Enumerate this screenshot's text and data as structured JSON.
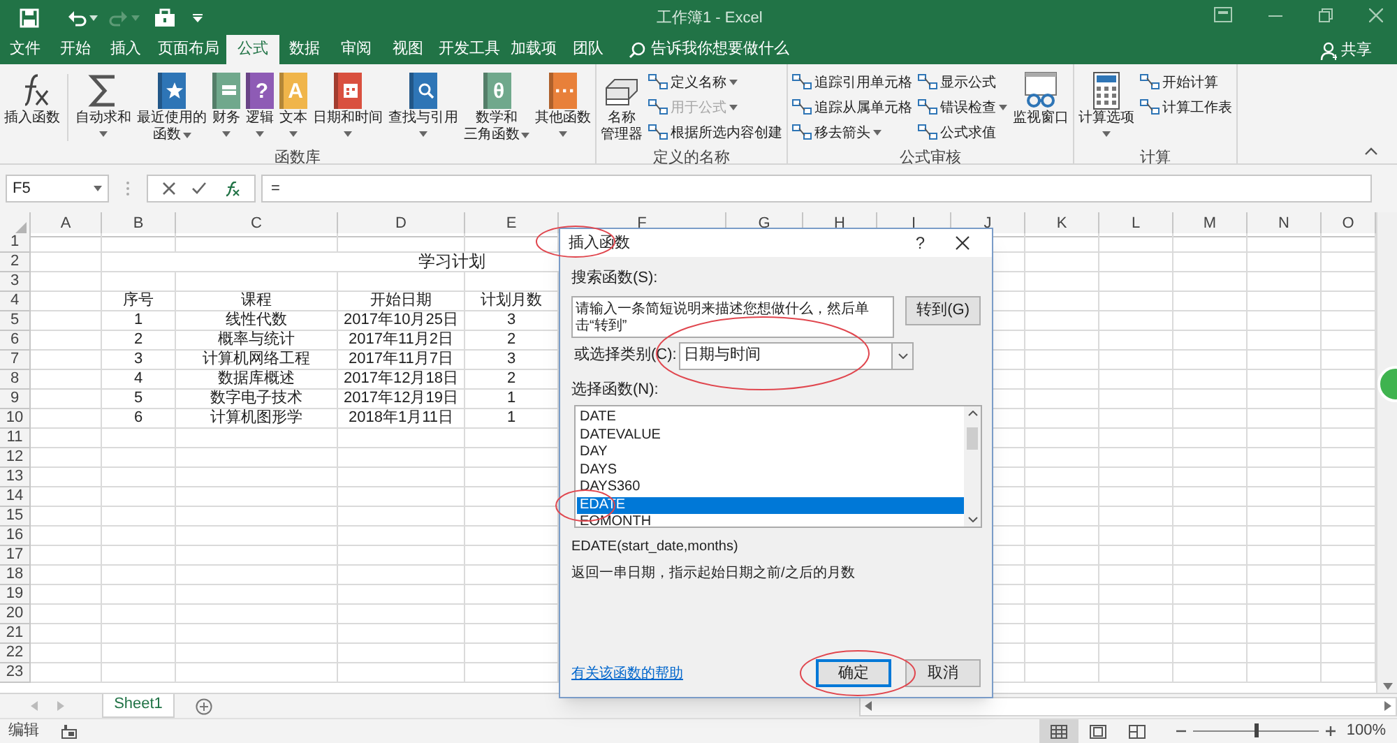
{
  "window": {
    "title": "工作簿1 - Excel"
  },
  "ribbon_tabs": [
    {
      "label": "文件",
      "selected": false
    },
    {
      "label": "开始",
      "selected": false
    },
    {
      "label": "插入",
      "selected": false
    },
    {
      "label": "页面布局",
      "selected": false
    },
    {
      "label": "公式",
      "selected": true
    },
    {
      "label": "数据",
      "selected": false
    },
    {
      "label": "审阅",
      "selected": false
    },
    {
      "label": "视图",
      "selected": false
    },
    {
      "label": "开发工具",
      "selected": false
    },
    {
      "label": "加载项",
      "selected": false
    },
    {
      "label": "团队",
      "selected": false
    }
  ],
  "tell_me": "告诉我你想要做什么",
  "share": "共享",
  "ribbon_groups": [
    {
      "label": "函数库",
      "buttons": [
        {
          "kind": "large",
          "lines": [
            "插入函数"
          ],
          "dropdown": false,
          "icon": {
            "kind": "fx"
          }
        },
        {
          "kind": "large",
          "lines": [
            "自动求和"
          ],
          "dropdown": true,
          "icon": {
            "kind": "sum"
          }
        },
        {
          "kind": "large",
          "lines": [
            "最近使用的",
            "函数"
          ],
          "dropdown": true,
          "icon": {
            "kind": "book_star",
            "color": "#2e75b6"
          }
        },
        {
          "kind": "large",
          "lines": [
            "财务"
          ],
          "dropdown": true,
          "icon": {
            "kind": "book_coins",
            "color": "#70a88c"
          }
        },
        {
          "kind": "large",
          "lines": [
            "逻辑"
          ],
          "dropdown": true,
          "icon": {
            "kind": "book",
            "color": "#8e5bb5",
            "glyph": "?"
          }
        },
        {
          "kind": "large",
          "lines": [
            "文本"
          ],
          "dropdown": true,
          "icon": {
            "kind": "book",
            "color": "#f0b54a",
            "glyph": "A"
          }
        },
        {
          "kind": "large",
          "lines": [
            "日期和时间"
          ],
          "dropdown": true,
          "icon": {
            "kind": "book_calendar",
            "color": "#d9503f"
          }
        },
        {
          "kind": "large",
          "lines": [
            "查找与引用"
          ],
          "dropdown": true,
          "icon": {
            "kind": "book_search",
            "color": "#2e75b6"
          }
        },
        {
          "kind": "large",
          "lines": [
            "数学和",
            "三角函数"
          ],
          "dropdown": true,
          "icon": {
            "kind": "book",
            "color": "#70a88c",
            "glyph": "θ"
          }
        },
        {
          "kind": "large",
          "lines": [
            "其他函数"
          ],
          "dropdown": true,
          "icon": {
            "kind": "book",
            "color": "#e8803a",
            "glyph": "···"
          }
        }
      ]
    },
    {
      "label": "定义的名称",
      "buttons": [
        {
          "kind": "large",
          "lines": [
            "名称",
            "管理器"
          ],
          "dropdown": false,
          "icon": {
            "kind": "names"
          }
        },
        {
          "kind": "small",
          "label": "定义名称",
          "dropdown": true,
          "disabled": false
        },
        {
          "kind": "small",
          "label": "用于公式",
          "dropdown": true,
          "disabled": true
        },
        {
          "kind": "small",
          "label": "根据所选内容创建",
          "dropdown": false,
          "disabled": false
        }
      ]
    },
    {
      "label": "公式审核",
      "buttons": [
        {
          "kind": "small",
          "label": "追踪引用单元格",
          "dropdown": false,
          "disabled": false
        },
        {
          "kind": "small",
          "label": "追踪从属单元格",
          "dropdown": false,
          "disabled": false
        },
        {
          "kind": "small",
          "label": "移去箭头",
          "dropdown": true,
          "disabled": false
        },
        {
          "kind": "small",
          "label": "显示公式",
          "dropdown": false,
          "disabled": false
        },
        {
          "kind": "small",
          "label": "错误检查",
          "dropdown": true,
          "disabled": false
        },
        {
          "kind": "small",
          "label": "公式求值",
          "dropdown": false,
          "disabled": false
        },
        {
          "kind": "large",
          "lines": [
            "监视窗口"
          ],
          "dropdown": false,
          "icon": {
            "kind": "watch"
          }
        }
      ]
    },
    {
      "label": "计算",
      "buttons": [
        {
          "kind": "large",
          "lines": [
            "计算选项"
          ],
          "dropdown": true,
          "icon": {
            "kind": "calc"
          }
        },
        {
          "kind": "small",
          "label": "开始计算",
          "dropdown": false,
          "disabled": false
        },
        {
          "kind": "small",
          "label": "计算工作表",
          "dropdown": false,
          "disabled": false
        }
      ]
    }
  ],
  "name_box": "F5",
  "formula": "=",
  "columns": [
    "A",
    "B",
    "C",
    "D",
    "E",
    "F",
    "G",
    "H",
    "I",
    "J",
    "K",
    "L",
    "M",
    "N",
    "O"
  ],
  "rows": [
    {
      "header": "1"
    },
    {
      "header": "2",
      "merged_title": "学习计划"
    },
    {
      "header": "3"
    },
    {
      "header": "4",
      "cells": [
        "",
        "序号",
        "课程",
        "开始日期",
        "计划月数"
      ]
    },
    {
      "header": "5",
      "cells": [
        "",
        "1",
        "线性代数",
        "2017年10月25日",
        "3"
      ]
    },
    {
      "header": "6",
      "cells": [
        "",
        "2",
        "概率与统计",
        "2017年11月2日",
        "2"
      ]
    },
    {
      "header": "7",
      "cells": [
        "",
        "3",
        "计算机网络工程",
        "2017年11月7日",
        "3"
      ]
    },
    {
      "header": "8",
      "cells": [
        "",
        "4",
        "数据库概述",
        "2017年12月18日",
        "2"
      ]
    },
    {
      "header": "9",
      "cells": [
        "",
        "5",
        "数字电子技术",
        "2017年12月19日",
        "1"
      ]
    },
    {
      "header": "10",
      "cells": [
        "",
        "6",
        "计算机图形学",
        "2018年1月11日",
        "1"
      ]
    },
    {
      "header": "11"
    },
    {
      "header": "12"
    },
    {
      "header": "13"
    },
    {
      "header": "14"
    },
    {
      "header": "15"
    },
    {
      "header": "16"
    },
    {
      "header": "17"
    },
    {
      "header": "18"
    },
    {
      "header": "19"
    },
    {
      "header": "20"
    },
    {
      "header": "21"
    },
    {
      "header": "22"
    },
    {
      "header": "23"
    }
  ],
  "sheet_tabs": [
    {
      "label": "Sheet1",
      "selected": true
    }
  ],
  "status": "编辑",
  "views": [
    {
      "kind": "normal",
      "selected": true
    },
    {
      "kind": "layout",
      "selected": false
    },
    {
      "kind": "pagebreak",
      "selected": false
    }
  ],
  "zoom": {
    "level": 0.5,
    "reading": "100%"
  },
  "dialog": {
    "title": "插入函数",
    "help": "?",
    "search_label": "搜索函数(S):",
    "search_value": "请输入一条简短说明来描述您想做什么，然后单击“转到”",
    "go_button": "转到(G)",
    "category_label": "或选择类别(C):",
    "category": "日期与时间",
    "list_label": "选择函数(N):",
    "functions": [
      {
        "label": "DATE",
        "selected": false
      },
      {
        "label": "DATEVALUE",
        "selected": false
      },
      {
        "label": "DAY",
        "selected": false
      },
      {
        "label": "DAYS",
        "selected": false
      },
      {
        "label": "DAYS360",
        "selected": false
      },
      {
        "label": "EDATE",
        "selected": true
      },
      {
        "label": "EOMONTH",
        "selected": false
      }
    ],
    "signature": "EDATE(start_date,months)",
    "description": "返回一串日期，指示起始日期之前/之后的月数",
    "help_link": "有关该函数的帮助",
    "ok": "确定",
    "cancel": "取消"
  }
}
